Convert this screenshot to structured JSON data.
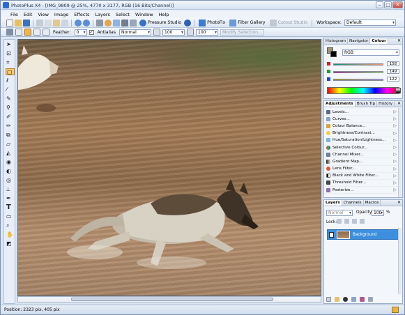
{
  "app": {
    "title": "PhotoPlus X4 - [IMG_9809 @ 25%, 4770 x 3177, RGB (16 Bits/Channel)]"
  },
  "window_controls": {
    "minimize": "–",
    "maximize": "□",
    "close": "✕"
  },
  "menu": [
    "File",
    "Edit",
    "View",
    "Image",
    "Effects",
    "Layers",
    "Select",
    "Window",
    "Help"
  ],
  "toolbar1": {
    "pressure_studio": "Pressure Studio",
    "photofix": "PhotoFix",
    "filter_gallery": "Filter Gallery",
    "cutout_studio": "Cutout Studio",
    "workspace_label": "Workspace:",
    "workspace_value": "Default"
  },
  "toolbar2": {
    "feather_label": "Feather:",
    "feather_value": "0",
    "antialias_label": "Antialias",
    "antialias_checked": "✓",
    "mode_value": "Normal",
    "width_value": "100",
    "height_value": "100",
    "modify_selection": "Modify Selection..."
  },
  "status": {
    "position": "Position: 2323 pix, 405 pix"
  },
  "colour_panel": {
    "tabs": [
      "Histogram",
      "Navigator",
      "Colour"
    ],
    "active_tab": "Colour",
    "mode": "RGB",
    "r": "158",
    "g": "149",
    "b": "122",
    "close": "✕"
  },
  "adjustments_panel": {
    "tabs": [
      "Adjustments",
      "Brush Tip",
      "History"
    ],
    "active_tab": "Adjustments",
    "close": "✕",
    "items": [
      "Levels...",
      "Curves...",
      "Colour Balance...",
      "Brightness/Contrast...",
      "Hue/Saturation/Lightness...",
      "Selective Colour...",
      "Channel Mixer...",
      "Gradient Map...",
      "Lens Filter...",
      "Black and White Filter...",
      "Threshold Filter...",
      "Posterize..."
    ]
  },
  "layers_panel": {
    "tabs": [
      "Layers",
      "Channels",
      "Macros"
    ],
    "active_tab": "Layers",
    "close": "✕",
    "blend_mode": "Normal",
    "opacity_label": "Opacity:",
    "opacity_value": "100",
    "opacity_unit": "%",
    "lock_label": "Lock:",
    "layer_name": "Background"
  }
}
